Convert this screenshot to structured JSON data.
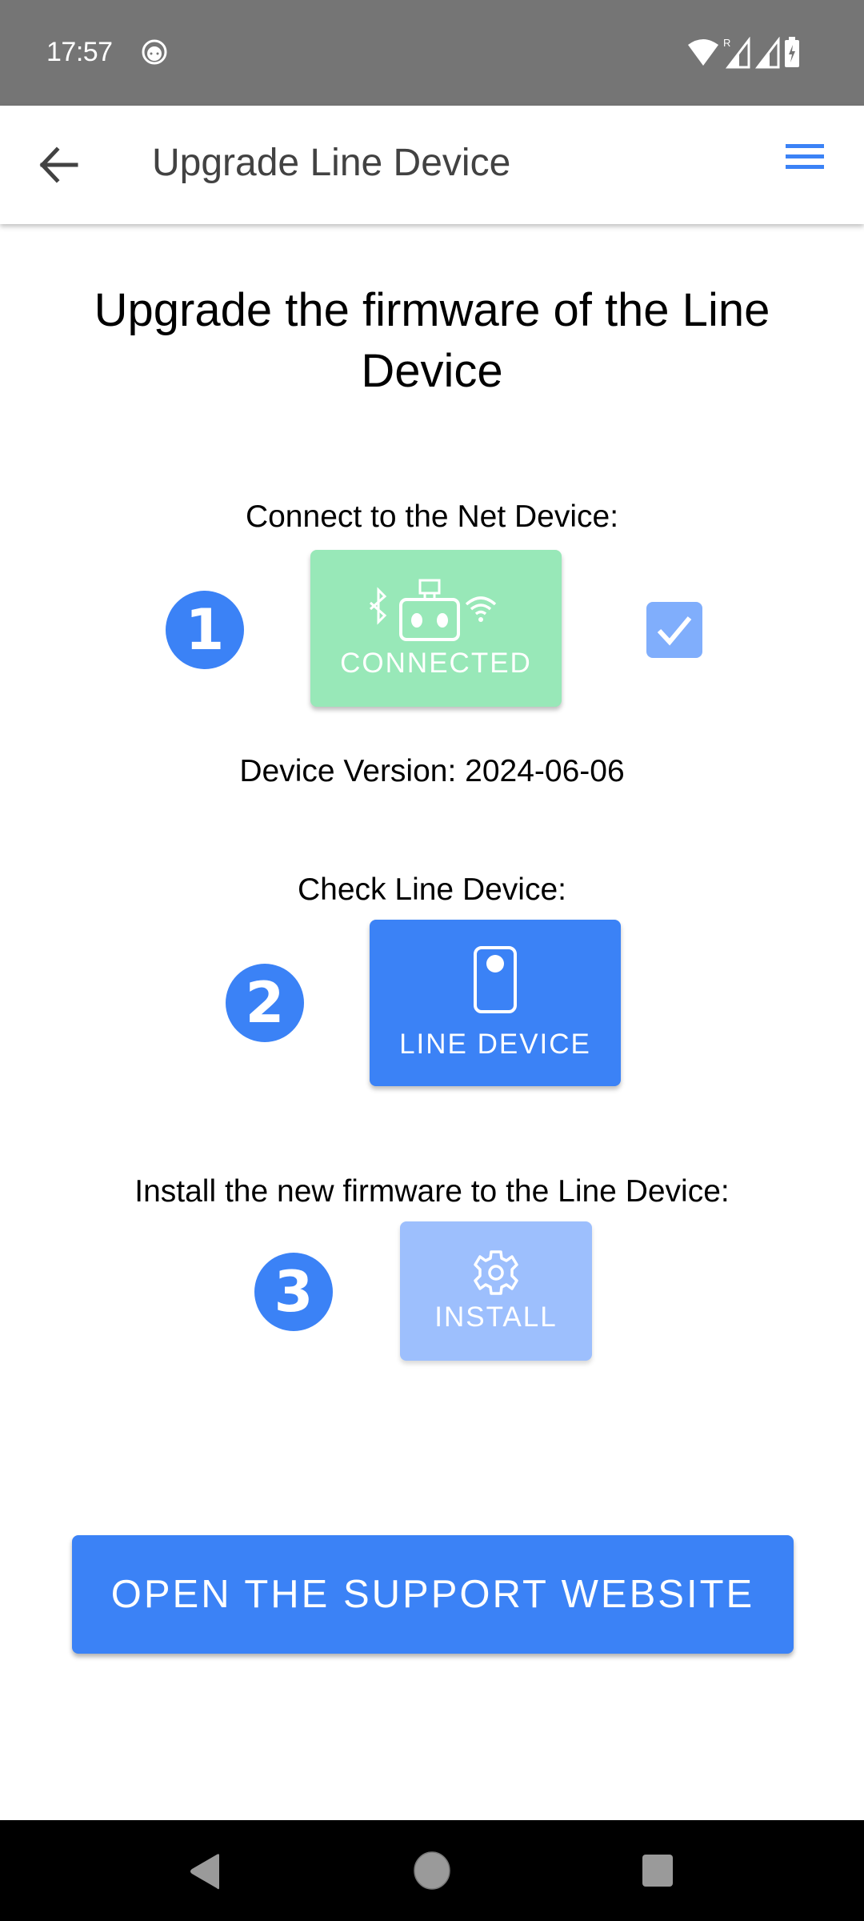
{
  "status_bar": {
    "time": "17:57",
    "roaming_indicator": "R",
    "icons": [
      "notification-app-icon",
      "wifi-icon",
      "signal-roaming-icon",
      "signal-icon",
      "battery-charging-icon"
    ]
  },
  "app_bar": {
    "title": "Upgrade Line Device",
    "back_icon": "arrow-left-icon",
    "menu_icon": "hamburger-menu-icon"
  },
  "main": {
    "heading": "Upgrade the firmware of the Line Device",
    "steps": [
      {
        "number": "1",
        "label": "Connect to the Net Device:",
        "button_label": "CONNECTED",
        "button_icon": "bluetooth-robot-wifi-icon",
        "state": "connected",
        "checked": true
      },
      {
        "number": "2",
        "label": "Check Line Device:",
        "button_label": "LINE DEVICE",
        "button_icon": "device-icon",
        "state": "enabled"
      },
      {
        "number": "3",
        "label": "Install the new firmware to the Line Device:",
        "button_label": "INSTALL",
        "button_icon": "gear-icon",
        "state": "disabled"
      }
    ],
    "device_version_label": "Device Version: 2024-06-06",
    "support_button_label": "OPEN THE SUPPORT WEBSITE"
  },
  "nav_bar": {
    "buttons": [
      "back",
      "home",
      "recents"
    ]
  },
  "colors": {
    "primary": "#3b82f6",
    "connected_green": "#98e8b8",
    "disabled_blue": "#9dbffd",
    "checkbox_blue": "#80aefc",
    "status_bar": "#757575"
  }
}
